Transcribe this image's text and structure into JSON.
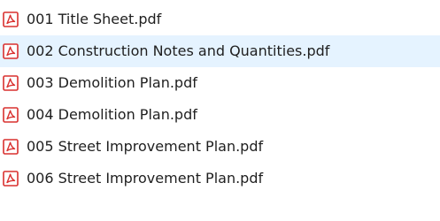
{
  "file_list": {
    "items": [
      {
        "name": "001 Title Sheet.pdf",
        "icon": "pdf-file-icon",
        "highlighted": false
      },
      {
        "name": "002 Construction Notes and Quantities.pdf",
        "icon": "pdf-file-icon",
        "highlighted": true
      },
      {
        "name": "003 Demolition Plan.pdf",
        "icon": "pdf-file-icon",
        "highlighted": false
      },
      {
        "name": "004 Demolition Plan.pdf",
        "icon": "pdf-file-icon",
        "highlighted": false
      },
      {
        "name": "005 Street Improvement Plan.pdf",
        "icon": "pdf-file-icon",
        "highlighted": false
      },
      {
        "name": "006 Street Improvement Plan.pdf",
        "icon": "pdf-file-icon",
        "highlighted": false
      }
    ]
  },
  "colors": {
    "hover_background": "#e5f3ff",
    "pdf_icon_red": "#d9302f",
    "text": "#1f1f1f"
  }
}
